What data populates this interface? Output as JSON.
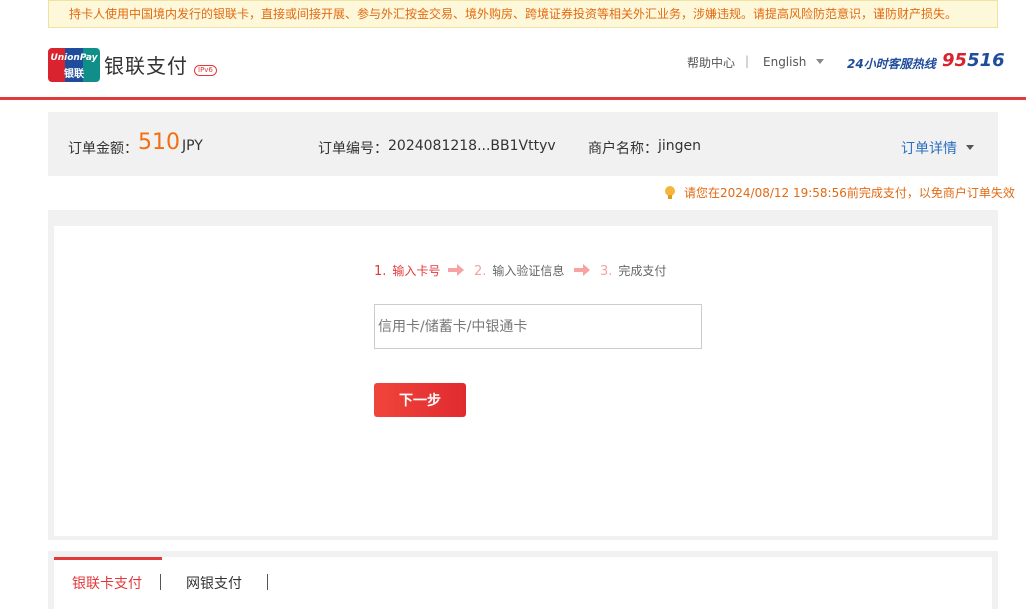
{
  "notice": {
    "text": "持卡人使用中国境内发行的银联卡，直接或间接开展、参与外汇按金交易、境外购房、跨境证券投资等相关外汇业务，涉嫌违规。请提高风险防范意识，谨防财产损失。"
  },
  "header": {
    "logo_top": "UnionPay",
    "logo_bottom": "银联",
    "brand": "银联支付",
    "ipv6_badge": "IPv6",
    "help": "帮助中心",
    "separator": "|",
    "language": "English",
    "hotline_label": "24小时客服热线",
    "hotline_prefix": "95",
    "hotline_suffix": "516"
  },
  "order": {
    "amount_label": "订单金额：",
    "amount": "510",
    "currency": "JPY",
    "number_label": "订单编号：",
    "number": "2024081218...BB1Vttyv",
    "merchant_label": "商户名称：",
    "merchant": "jingen",
    "details_label": "订单详情"
  },
  "deadline": {
    "text": "请您在2024/08/12 19:58:56前完成支付，以免商户订单失效"
  },
  "steps": [
    {
      "num": "1.",
      "label": "输入卡号"
    },
    {
      "num": "2.",
      "label": "输入验证信息"
    },
    {
      "num": "3.",
      "label": "完成支付"
    }
  ],
  "card_input": {
    "placeholder": "信用卡/储蓄卡/中银通卡",
    "value": ""
  },
  "next_button": "下一步",
  "tabs": [
    {
      "label": "银联卡支付",
      "active": true
    },
    {
      "label": "网银支付",
      "active": false
    }
  ],
  "colors": {
    "accent_red": "#e2393b",
    "amount_orange": "#f56e0f",
    "link_blue": "#2b6fc2",
    "brand_blue": "#1f4d9b"
  }
}
